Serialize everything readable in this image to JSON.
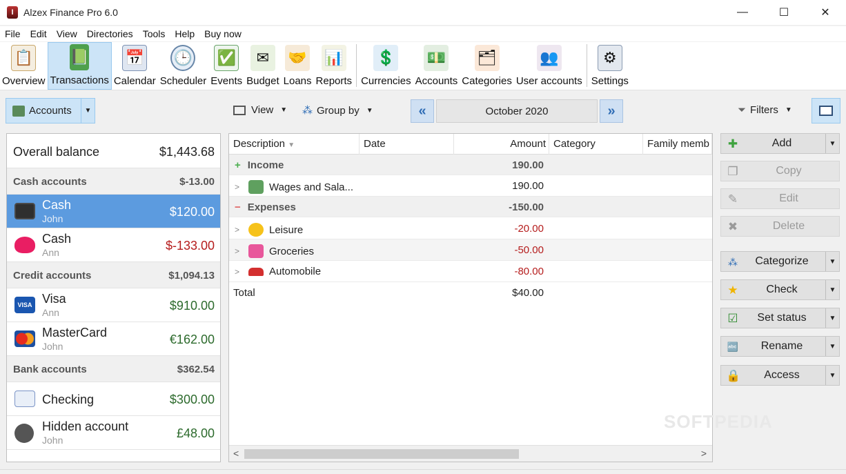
{
  "window": {
    "title": "Alzex Finance Pro 6.0",
    "minimize": "—",
    "maximize": "☐",
    "close": "✕"
  },
  "menu": [
    "File",
    "Edit",
    "View",
    "Directories",
    "Tools",
    "Help",
    "Buy now"
  ],
  "toolbar": [
    {
      "label": "Overview",
      "icon": "overview-icon"
    },
    {
      "label": "Transactions",
      "icon": "transactions-icon"
    },
    {
      "label": "Calendar",
      "icon": "calendar-icon"
    },
    {
      "label": "Scheduler",
      "icon": "scheduler-icon"
    },
    {
      "label": "Events",
      "icon": "events-icon"
    },
    {
      "label": "Budget",
      "icon": "budget-icon"
    },
    {
      "label": "Loans",
      "icon": "loans-icon"
    },
    {
      "label": "Reports",
      "icon": "reports-icon"
    },
    {
      "label": "Currencies",
      "icon": "currencies-icon"
    },
    {
      "label": "Accounts",
      "icon": "accounts-icon"
    },
    {
      "label": "Categories",
      "icon": "categories-icon"
    },
    {
      "label": "User accounts",
      "icon": "user-accounts-icon"
    },
    {
      "label": "Settings",
      "icon": "settings-icon"
    }
  ],
  "subbar": {
    "accounts": "Accounts",
    "view": "View",
    "group_by": "Group by",
    "month": "October 2020",
    "filters": "Filters"
  },
  "accounts_panel": {
    "overall": {
      "label": "Overall balance",
      "value": "$1,443.68"
    },
    "groups": [
      {
        "label": "Cash accounts",
        "value": "$-13.00"
      },
      {
        "label": "Credit accounts",
        "value": "$1,094.13"
      },
      {
        "label": "Bank accounts",
        "value": "$362.54"
      }
    ],
    "accounts": [
      {
        "name": "Cash",
        "owner": "John",
        "value": "$120.00"
      },
      {
        "name": "Cash",
        "owner": "Ann",
        "value": "$-133.00"
      },
      {
        "name": "Visa",
        "owner": "Ann",
        "value": "$910.00"
      },
      {
        "name": "MasterCard",
        "owner": "John",
        "value": "€162.00"
      },
      {
        "name": "Checking",
        "owner": "",
        "value": "$300.00"
      },
      {
        "name": "Hidden account",
        "owner": "John",
        "value": "£48.00"
      }
    ]
  },
  "grid": {
    "columns": [
      "Description",
      "Date",
      "Amount",
      "Category",
      "Family memb"
    ],
    "income": {
      "label": "Income",
      "amount": "190.00"
    },
    "income_rows": [
      {
        "desc": "Wages and Sala...",
        "amount": "190.00"
      }
    ],
    "expenses": {
      "label": "Expenses",
      "amount": "-150.00"
    },
    "expense_rows": [
      {
        "desc": "Leisure",
        "amount": "-20.00"
      },
      {
        "desc": "Groceries",
        "amount": "-50.00"
      },
      {
        "desc": "Automobile",
        "amount": "-80.00"
      }
    ],
    "total": {
      "label": "Total",
      "amount": "$40.00"
    }
  },
  "actions": [
    {
      "label": "Add",
      "enabled": true
    },
    {
      "label": "Copy",
      "enabled": false
    },
    {
      "label": "Edit",
      "enabled": false
    },
    {
      "label": "Delete",
      "enabled": false
    },
    {
      "label": "Categorize",
      "enabled": true
    },
    {
      "label": "Check",
      "enabled": true
    },
    {
      "label": "Set status",
      "enabled": true
    },
    {
      "label": "Rename",
      "enabled": true
    },
    {
      "label": "Access",
      "enabled": true
    }
  ],
  "watermark": "SOFTPEDIA"
}
